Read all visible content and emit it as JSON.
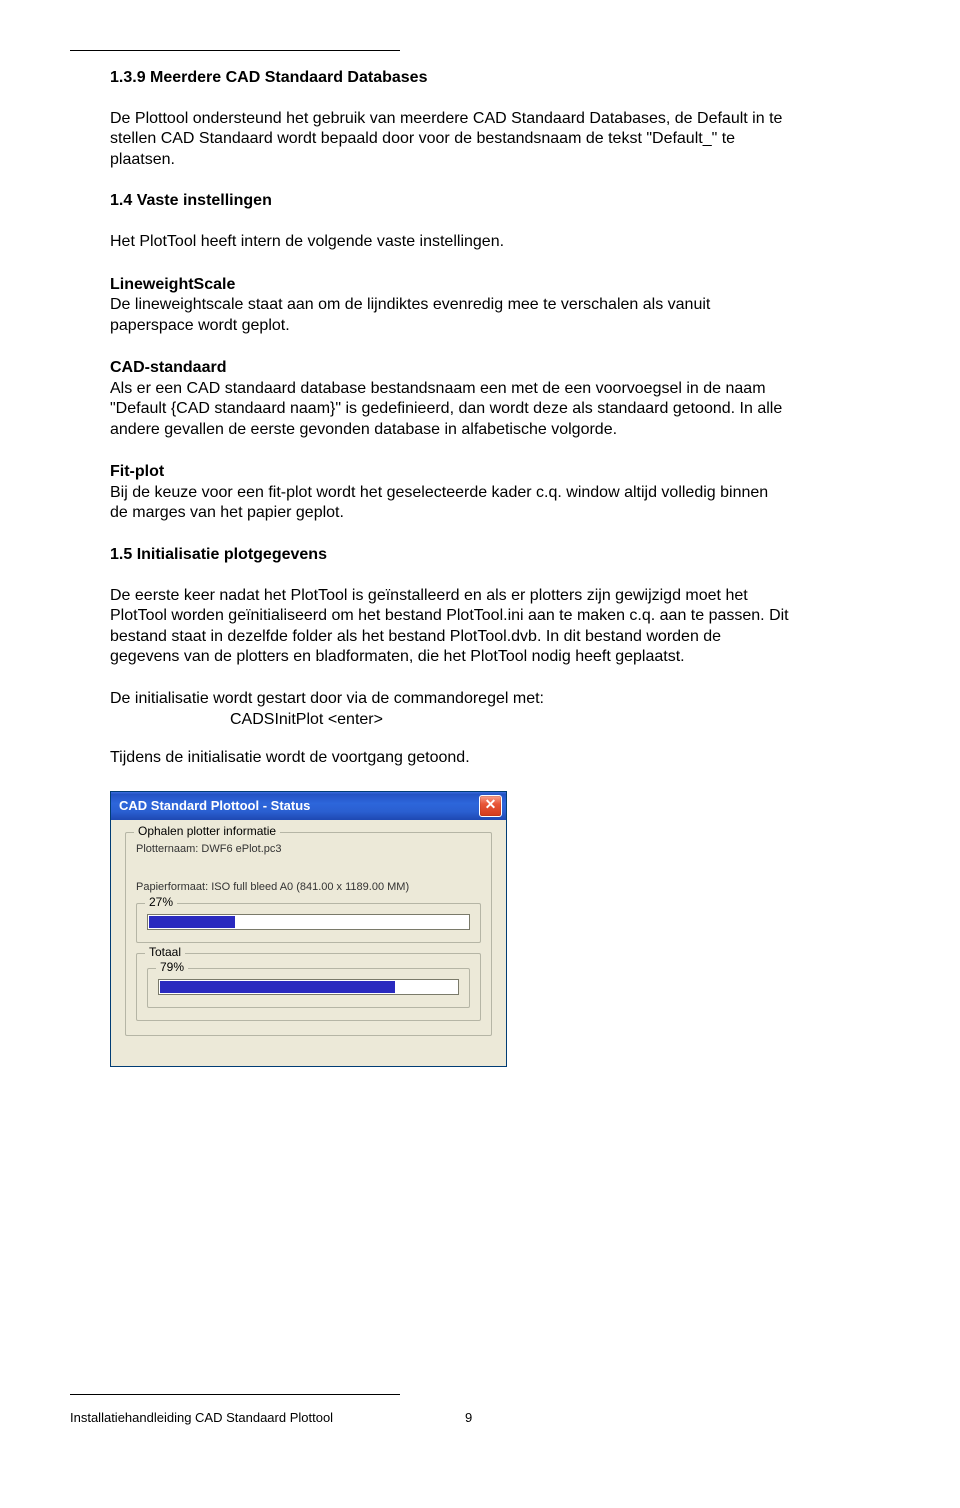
{
  "sections": {
    "s139": {
      "title": "1.3.9 Meerdere CAD Standaard Databases",
      "p1": "De Plottool ondersteund het gebruik van meerdere CAD Standaard Databases, de Default in te stellen CAD Standaard wordt bepaald door voor de bestandsnaam de tekst \"Default_\" te plaatsen."
    },
    "s14": {
      "title": "1.4 Vaste instellingen",
      "intro": "Het PlotTool heeft intern de volgende vaste instellingen.",
      "lw_label": "LineweightScale",
      "lw_text": "De lineweightscale staat aan om de lijndiktes evenredig mee te verschalen als vanuit paperspace wordt geplot.",
      "cad_label": "CAD-standaard",
      "cad_text": "Als er een CAD standaard database bestandsnaam een met de een voorvoegsel in de naam \"Default {CAD standaard naam}\" is gedefinieerd, dan wordt deze als standaard getoond. In alle andere gevallen de eerste gevonden database in alfabetische volgorde.",
      "fit_label": "Fit-plot",
      "fit_text": "Bij de keuze voor een fit-plot wordt het geselecteerde kader c.q. window altijd volledig binnen de marges van het papier geplot."
    },
    "s15": {
      "title": "1.5 Initialisatie plotgegevens",
      "p1": "De eerste keer nadat het PlotTool is geïnstalleerd en als er plotters zijn gewijzigd moet het PlotTool worden geïnitialiseerd om het bestand PlotTool.ini aan te maken c.q. aan te passen. Dit bestand staat in dezelfde folder als het bestand PlotTool.dvb. In dit bestand worden de gegevens van de plotters en bladformaten, die het PlotTool nodig heeft geplaatst.",
      "p2": "De initialisatie wordt gestart door via de commandoregel met:",
      "cmd": "CADSInitPlot <enter>",
      "p3": "Tijdens de initialisatie wordt de voortgang getoond."
    }
  },
  "dialog": {
    "title": "CAD Standard Plottool - Status",
    "group1_title": "Ophalen plotter informatie",
    "plotter_line": "Plotternaam: DWF6 ePlot.pc3",
    "paper_line": "Papierformaat: ISO full bleed A0 (841.00 x 1189.00 MM)",
    "p1_label": "27%",
    "p1_pct": 27,
    "total_label": "Totaal",
    "p2_label": "79%",
    "p2_pct": 79
  },
  "footer": {
    "doc": "Installatiehandleiding CAD Standaard Plottool",
    "page": "9"
  }
}
